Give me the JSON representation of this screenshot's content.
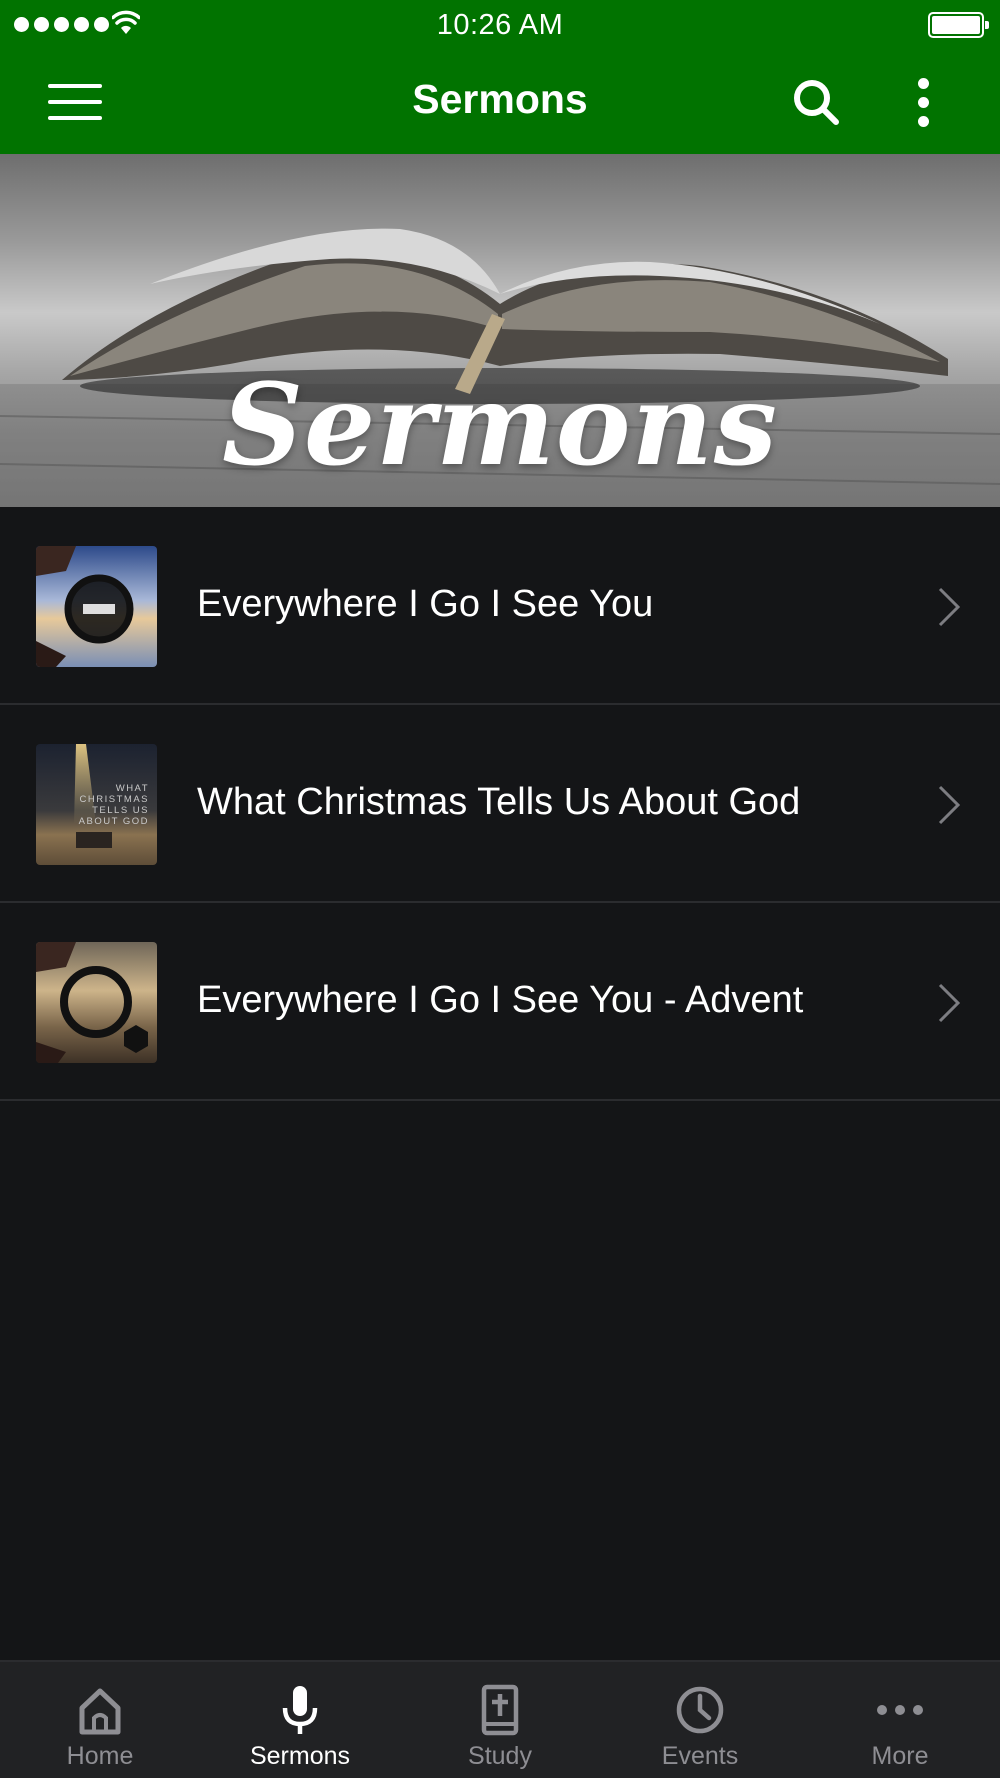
{
  "status_bar": {
    "time": "10:26 AM"
  },
  "nav_bar": {
    "title": "Sermons",
    "background_color": "#017300"
  },
  "banner": {
    "text": "Sermons"
  },
  "sermons": [
    {
      "title": "Everywhere I Go I See You"
    },
    {
      "title": "What Christmas Tells Us About God",
      "thumb_text": "WHAT CHRISTMAS TELLS US ABOUT GOD"
    },
    {
      "title": "Everywhere I Go I See You - Advent"
    }
  ],
  "tab_bar": {
    "tabs": [
      {
        "label": "Home",
        "icon": "home-icon",
        "active": false
      },
      {
        "label": "Sermons",
        "icon": "microphone-icon",
        "active": true
      },
      {
        "label": "Study",
        "icon": "bible-icon",
        "active": false
      },
      {
        "label": "Events",
        "icon": "clock-icon",
        "active": false
      },
      {
        "label": "More",
        "icon": "more-icon",
        "active": false
      }
    ]
  }
}
